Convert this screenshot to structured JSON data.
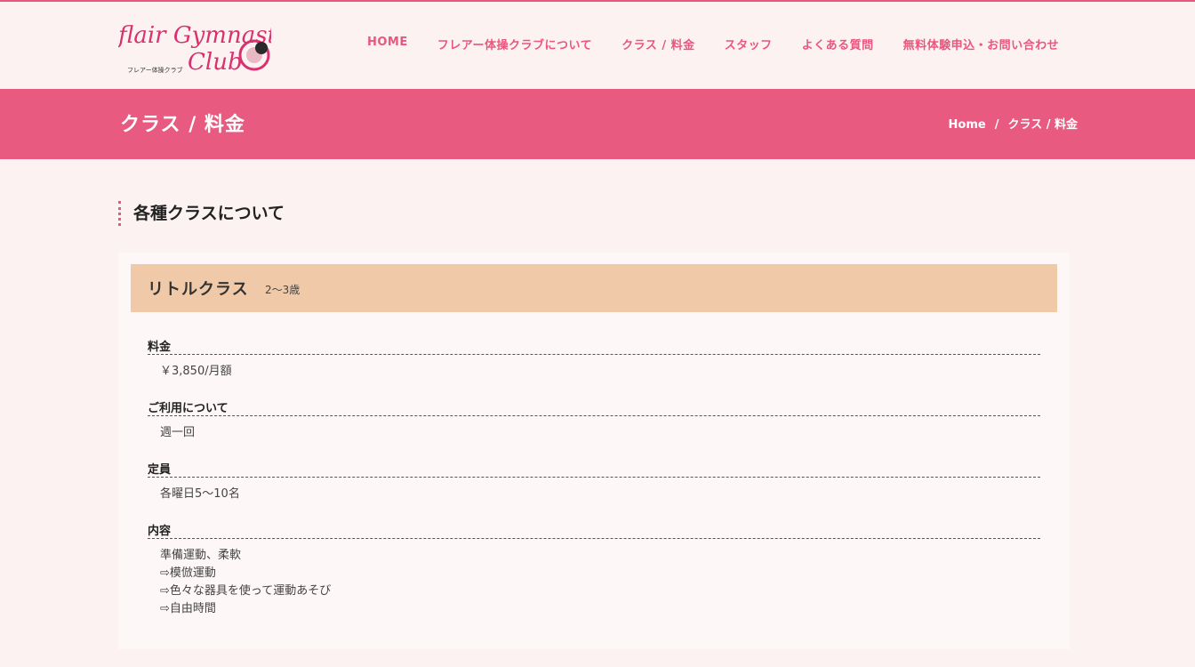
{
  "header": {
    "logo_text": "flair Gymnastics Club",
    "logo_subtext": "フレアー体操クラブ",
    "nav": [
      {
        "label": "HOME"
      },
      {
        "label": "フレアー体操クラブについて"
      },
      {
        "label": "クラス / 料金"
      },
      {
        "label": "スタッフ"
      },
      {
        "label": "よくある質問"
      },
      {
        "label": "無料体験申込・お問い合わせ"
      }
    ],
    "accent_color": "#e8577d"
  },
  "banner": {
    "title": "クラス / 料金",
    "breadcrumb": {
      "home": "Home",
      "separator": "/",
      "current": "クラス / 料金"
    },
    "background_color": "#e85a7f"
  },
  "section": {
    "title": "各種クラスについて"
  },
  "class": {
    "name": "リトルクラス",
    "age": "2〜3歳",
    "header_color": "#f0c9a9",
    "rows": [
      {
        "label": "料金",
        "value": [
          "￥3,850/月額"
        ]
      },
      {
        "label": "ご利用について",
        "value": [
          "週一回"
        ]
      },
      {
        "label": "定員",
        "value": [
          "各曜日5〜10名"
        ]
      },
      {
        "label": "内容",
        "value": [
          "準備運動、柔軟",
          "⇨模倣運動",
          "⇨色々な器具を使って運動あそび",
          "⇨自由時間"
        ]
      }
    ]
  }
}
